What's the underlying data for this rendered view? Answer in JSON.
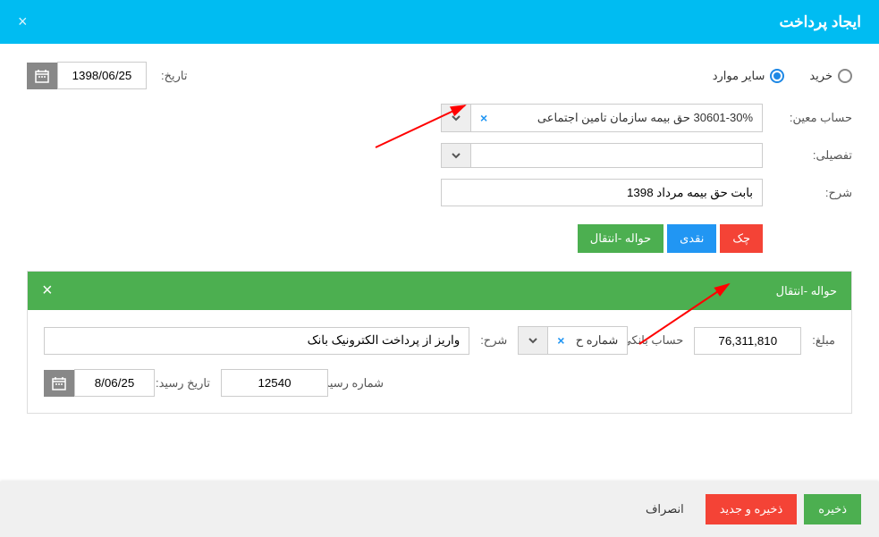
{
  "header": {
    "title": "ایجاد پرداخت"
  },
  "radio": {
    "buy": "خرید",
    "other": "سایر موارد"
  },
  "date": {
    "label": "تاریخ:",
    "value": "1398/06/25"
  },
  "account": {
    "label": "حساب معین:",
    "value": "30601-30% حق بیمه سازمان تامین اجتماعی"
  },
  "detail": {
    "label": "تفصیلی:",
    "value": ""
  },
  "desc": {
    "label": "شرح:",
    "value": "بابت حق بیمه مرداد 1398"
  },
  "tabs": {
    "check": "چک",
    "cash": "نقدی",
    "transfer": "حواله -انتقال"
  },
  "panel": {
    "title": "حواله -انتقال",
    "amount_label": "مبلغ:",
    "amount": "76,311,810",
    "bank_label": "حساب بانکی:",
    "bank_num_label": "شماره ح",
    "desc_label": "شرح:",
    "desc": "واریز از پرداخت الکترونیک بانک",
    "receipt_num_label": "شماره رسید:",
    "receipt_num": "12540",
    "receipt_date_label": "تاریخ رسید:",
    "receipt_date": "8/06/25"
  },
  "footer": {
    "save": "ذخیره",
    "save_new": "ذخیره و جدید",
    "cancel": "انصراف"
  }
}
